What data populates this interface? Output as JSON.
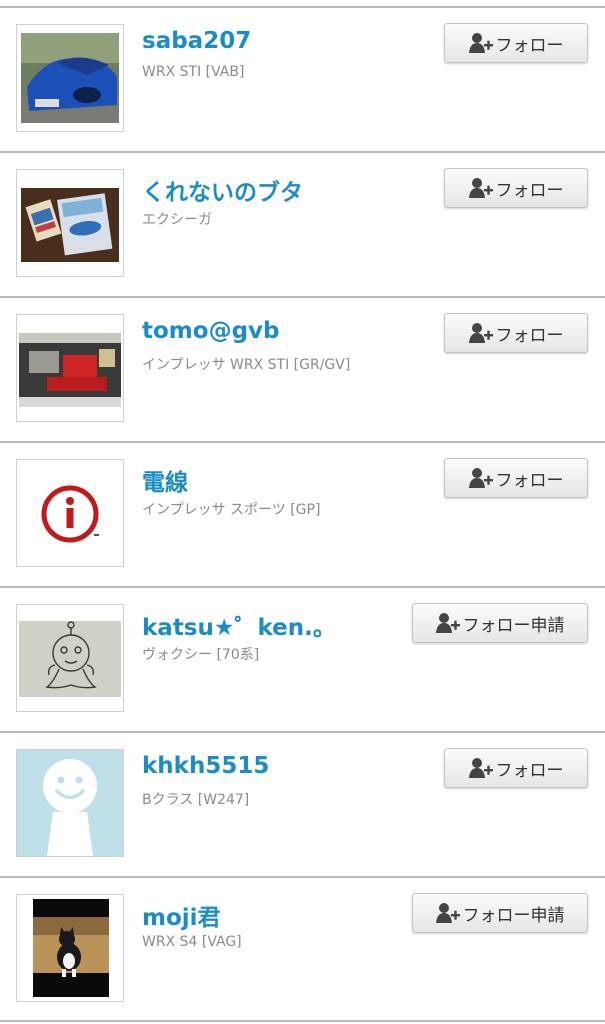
{
  "users": [
    {
      "name": "saba207",
      "car": "WRX STI [VAB]",
      "button_label": "フォロー",
      "avatar_icon": "blue-car-photo"
    },
    {
      "name": "くれないのブタ",
      "car": "エクシーガ",
      "button_label": "フォロー",
      "avatar_icon": "car-brochures-photo"
    },
    {
      "name": "tomo@gvb",
      "car": "インプレッサ WRX STI [GR/GV]",
      "button_label": "フォロー",
      "avatar_icon": "engine-bay-photo"
    },
    {
      "name": "電線",
      "car": "インプレッサ スポーツ [GP]",
      "button_label": "フォロー",
      "avatar_icon": "red-info-logo"
    },
    {
      "name": "katsu★゜ken.。",
      "car": "ヴォクシー [70系]",
      "button_label": "フォロー申請",
      "avatar_icon": "doodle-character"
    },
    {
      "name": "khkh5515",
      "car": "Bクラス [W247]",
      "button_label": "フォロー",
      "avatar_icon": "default-smiley-avatar"
    },
    {
      "name": "moji君",
      "car": "WRX S4 [VAG]",
      "button_label": "フォロー申請",
      "avatar_icon": "cat-photo"
    }
  ],
  "colors": {
    "username": "#1c8dc4",
    "subtext": "#8a8a8a",
    "divider": "#b8b8b8",
    "button_text": "#333333"
  }
}
